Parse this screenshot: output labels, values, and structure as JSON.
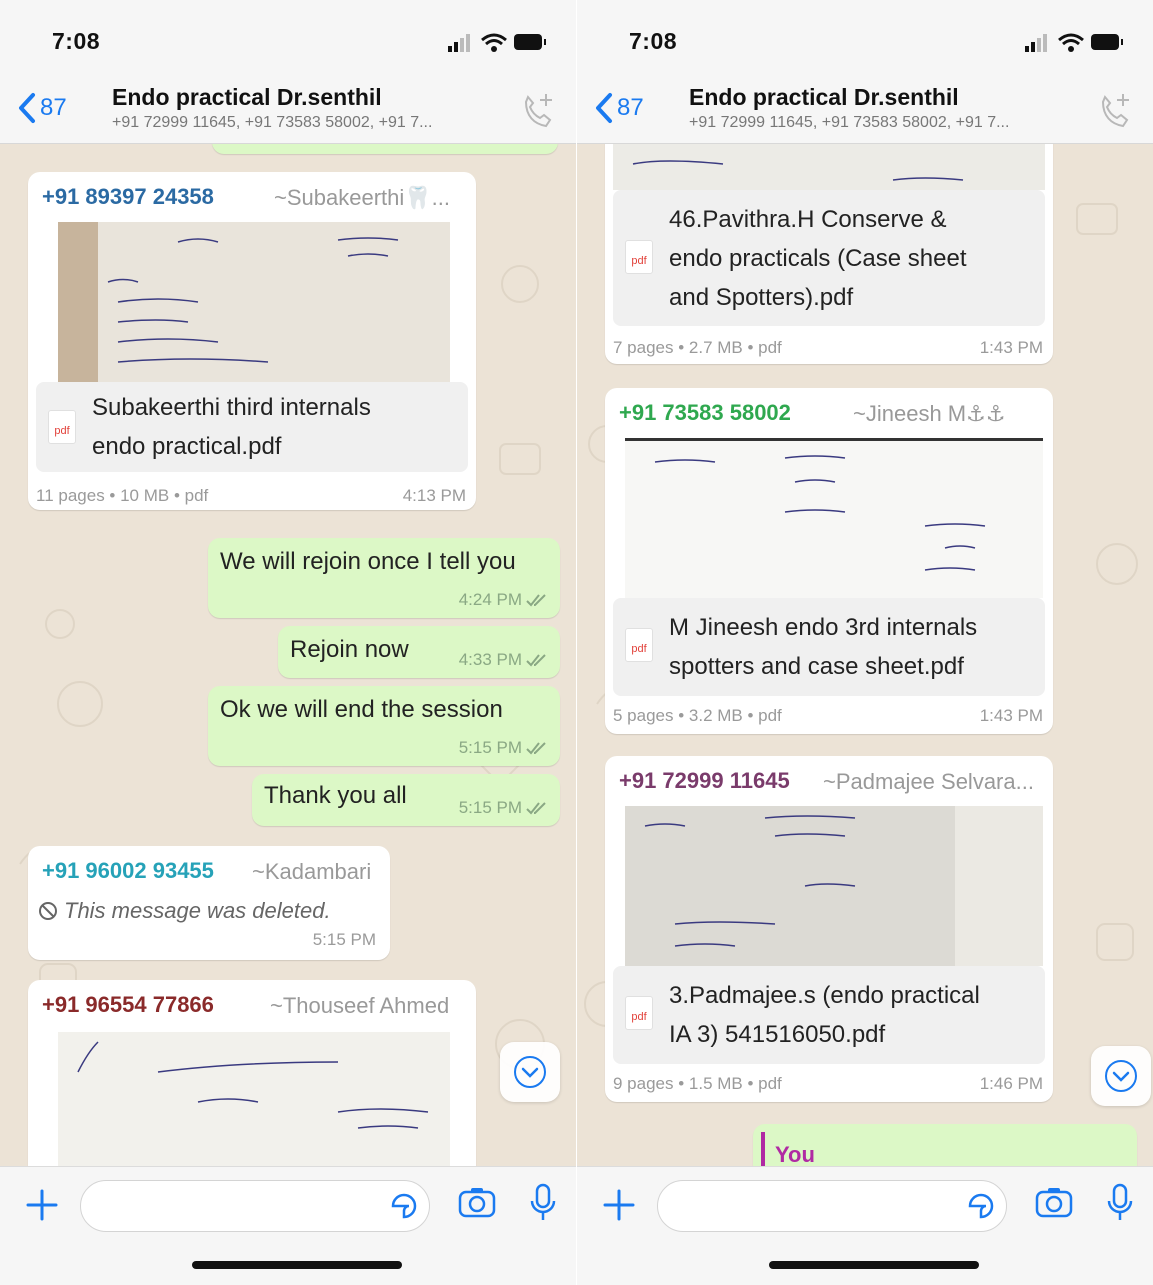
{
  "status": {
    "time": "7:08"
  },
  "header": {
    "back_count": "87",
    "title": "Endo practical Dr.senthil",
    "participants": "+91 72999 11645, +91 73583 58002, +91 7..."
  },
  "colors": {
    "link_blue": "#1a7af0",
    "outgoing_bubble": "#dcf8c6",
    "chat_bg": "#ece3d6",
    "sender_subakeerthi": "#2b6aa3",
    "sender_jineesh": "#2fa84f",
    "sender_padmajee": "#7a3b6b",
    "sender_kadambari": "#26a2b8",
    "sender_thouseef": "#8a2a2a"
  },
  "left": {
    "messages": {
      "m1": {
        "sender": "+91 89397 24358",
        "alias": "~Subakeerthi🦷...",
        "doc_name_l1": "Subakeerthi third internals",
        "doc_name_l2": "endo practical.pdf",
        "pdf_label": "pdf",
        "meta": "11 pages • 10 MB • pdf",
        "time": "4:13 PM"
      },
      "m2": {
        "text": "We will rejoin once I tell you",
        "time": "4:24 PM"
      },
      "m3": {
        "text": "Rejoin now",
        "time": "4:33 PM"
      },
      "m4": {
        "text": "Ok we will end the session",
        "time": "5:15 PM"
      },
      "m5": {
        "text": "Thank you all",
        "time": "5:15 PM"
      },
      "m6": {
        "sender": "+91 96002 93455",
        "alias": "~Kadambari",
        "deleted_text": "This message was deleted.",
        "time": "5:15 PM"
      },
      "m7": {
        "sender": "+91 96554 77866",
        "alias": "~Thouseef Ahmed"
      }
    }
  },
  "right": {
    "messages": {
      "r1": {
        "doc_name_l1": "46.Pavithra.H Conserve &",
        "doc_name_l2": "endo practicals (Case sheet",
        "doc_name_l3": "and Spotters).pdf",
        "pdf_label": "pdf",
        "meta": "7 pages • 2.7 MB • pdf",
        "time": "1:43 PM"
      },
      "r2": {
        "sender": "+91 73583 58002",
        "alias": "~Jineesh M⚓⚓",
        "doc_name_l1": "M Jineesh endo 3rd internals",
        "doc_name_l2": "spotters and case sheet.pdf",
        "pdf_label": "pdf",
        "meta": "5 pages • 3.2 MB • pdf",
        "time": "1:43 PM"
      },
      "r3": {
        "sender": "+91 72999 11645",
        "alias": "~Padmajee Selvara...",
        "doc_name_l1": "3.Padmajee.s (endo practical",
        "doc_name_l2": "IA 3) 541516050.pdf",
        "pdf_label": "pdf",
        "meta": "9 pages • 1.5 MB • pdf",
        "time": "1:46 PM"
      },
      "r4": {
        "reply_author": "You"
      }
    }
  },
  "icons": {
    "back": "chevron-left-icon",
    "add_call": "phone-plus-icon",
    "scroll_down": "chevron-down-circle-icon",
    "plus": "plus-icon",
    "sticker": "sticker-icon",
    "camera": "camera-icon",
    "mic": "microphone-icon",
    "read": "double-check-icon",
    "deleted": "prohibited-icon",
    "signal": "signal-icon",
    "wifi": "wifi-icon",
    "battery": "battery-icon"
  }
}
